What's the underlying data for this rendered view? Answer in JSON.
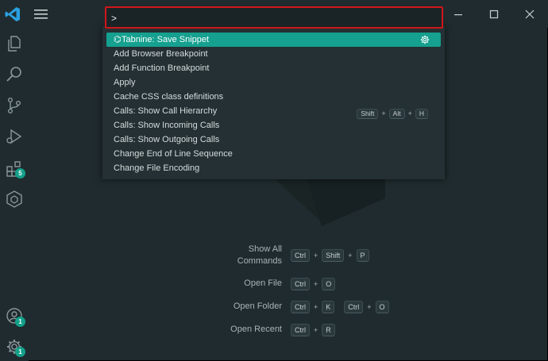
{
  "command_palette": {
    "input_value": ">",
    "items": [
      {
        "label": "Tabnine: Save Snippet",
        "selected": true,
        "prefix_icon": "tabnine-icon",
        "trailing_icon": "gear-icon"
      },
      {
        "label": "Add Browser Breakpoint"
      },
      {
        "label": "Add Function Breakpoint"
      },
      {
        "label": "Apply"
      },
      {
        "label": "Cache CSS class definitions"
      },
      {
        "label": "Calls: Show Call Hierarchy",
        "keys": [
          "Shift",
          "Alt",
          "H"
        ]
      },
      {
        "label": "Calls: Show Incoming Calls"
      },
      {
        "label": "Calls: Show Outgoing Calls"
      },
      {
        "label": "Change End of Line Sequence"
      },
      {
        "label": "Change File Encoding"
      }
    ],
    "plus": "+"
  },
  "activity_bar": {
    "extensions_badge": "5",
    "accounts_badge": "1",
    "settings_badge": "1"
  },
  "welcome_shortcuts": [
    {
      "label_line1": "Show All",
      "label_line2": "Commands",
      "keys": [
        "Ctrl",
        "Shift",
        "P"
      ]
    },
    {
      "label_line1": "Open File",
      "keys": [
        "Ctrl",
        "O"
      ]
    },
    {
      "label_line1": "Open Folder",
      "keys": [
        "Ctrl",
        "K"
      ],
      "keys2": [
        "Ctrl",
        "O"
      ]
    },
    {
      "label_line1": "Open Recent",
      "keys": [
        "Ctrl",
        "R"
      ]
    }
  ],
  "colors": {
    "background": "#1f2b2e",
    "accent": "#15a08f",
    "highlight_border": "#d0161a"
  }
}
